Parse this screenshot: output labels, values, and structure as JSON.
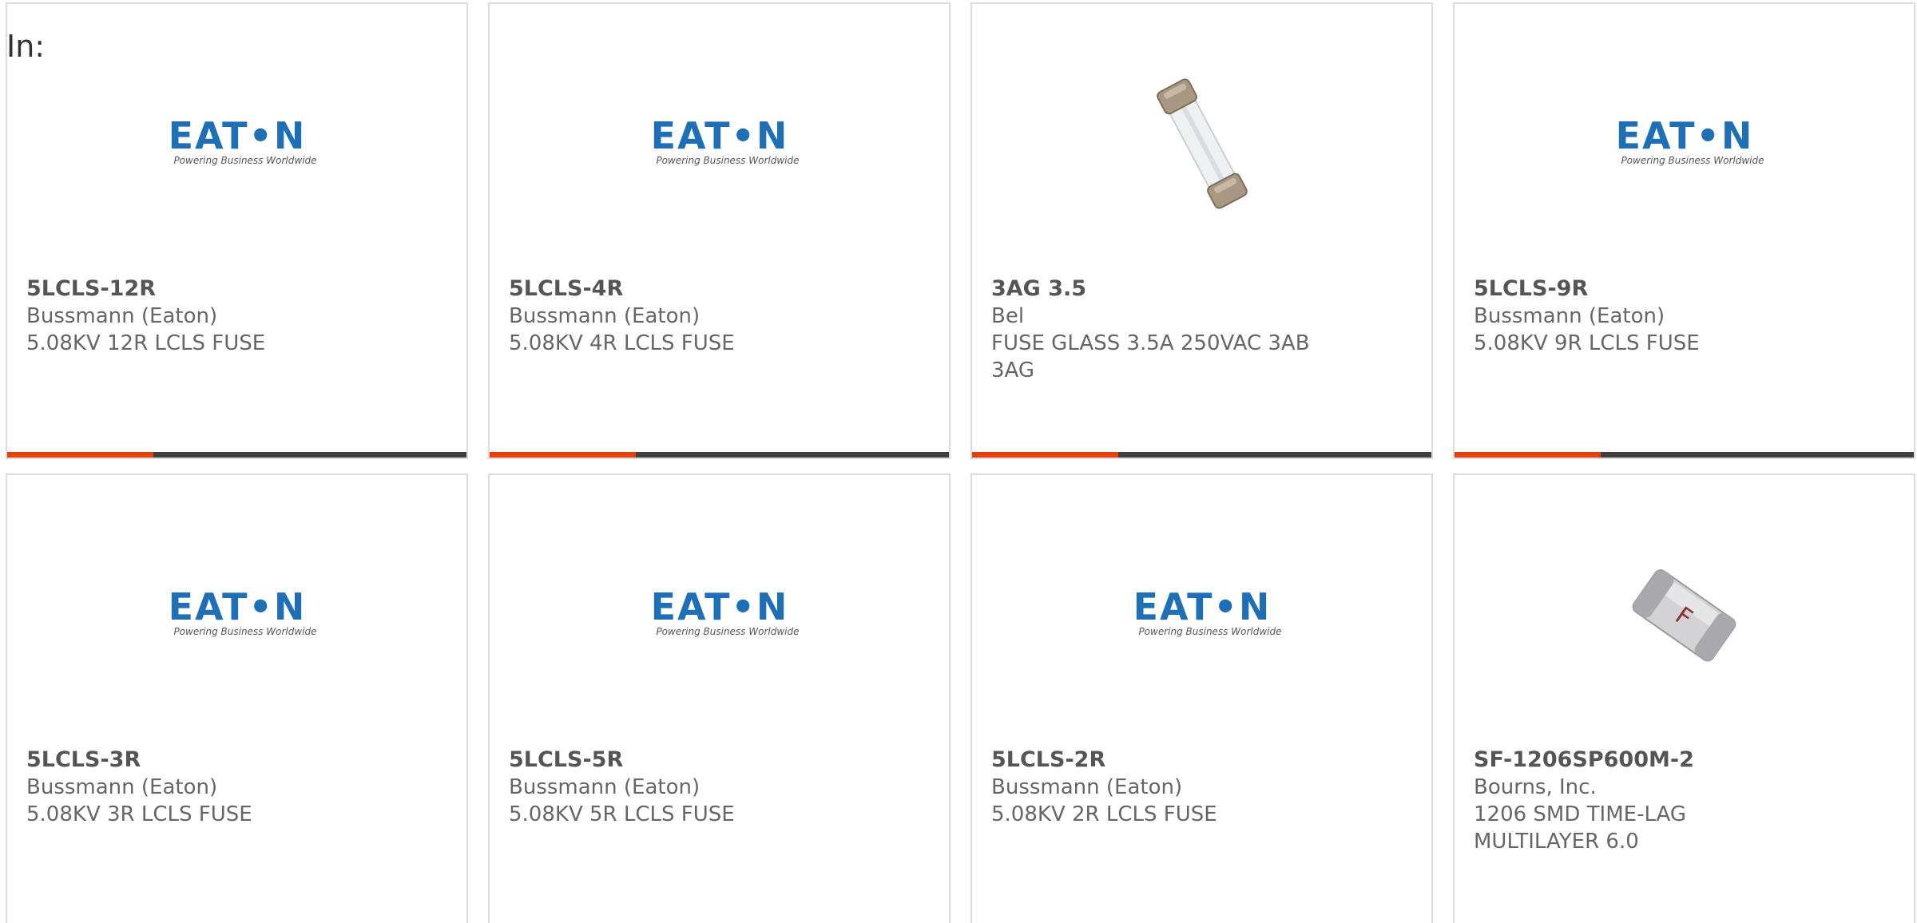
{
  "header": {
    "in_label": "In:"
  },
  "brand": {
    "eaton_wordmark": "EATON",
    "eaton_tagline": "Powering Business Worldwide"
  },
  "colors": {
    "accent": "#e5400e",
    "bar": "#3f3f3f",
    "eaton_blue": "#1f6fb7"
  },
  "products": [
    {
      "part": "5LCLS-12R",
      "manufacturer": "Bussmann (Eaton)",
      "desc1": "5.08KV 12R LCLS FUSE",
      "desc2": "",
      "image": "eaton-logo"
    },
    {
      "part": "5LCLS-4R",
      "manufacturer": "Bussmann (Eaton)",
      "desc1": "5.08KV 4R LCLS FUSE",
      "desc2": "",
      "image": "eaton-logo"
    },
    {
      "part": "3AG 3.5",
      "manufacturer": "Bel",
      "desc1": "FUSE GLASS 3.5A 250VAC 3AB",
      "desc2": "3AG",
      "image": "glass-fuse-photo"
    },
    {
      "part": "5LCLS-9R",
      "manufacturer": "Bussmann (Eaton)",
      "desc1": "5.08KV 9R LCLS FUSE",
      "desc2": "",
      "image": "eaton-logo"
    },
    {
      "part": "5LCLS-3R",
      "manufacturer": "Bussmann (Eaton)",
      "desc1": "5.08KV 3R LCLS FUSE",
      "desc2": "",
      "image": "eaton-logo"
    },
    {
      "part": "5LCLS-5R",
      "manufacturer": "Bussmann (Eaton)",
      "desc1": "5.08KV 5R LCLS FUSE",
      "desc2": "",
      "image": "eaton-logo"
    },
    {
      "part": "5LCLS-2R",
      "manufacturer": "Bussmann (Eaton)",
      "desc1": "5.08KV 2R LCLS FUSE",
      "desc2": "",
      "image": "eaton-logo"
    },
    {
      "part": "SF-1206SP600M-2",
      "manufacturer": "Bourns, Inc.",
      "desc1": "1206 SMD TIME-LAG",
      "desc2": "MULTILAYER 6.0",
      "image": "smd-fuse-photo"
    }
  ]
}
